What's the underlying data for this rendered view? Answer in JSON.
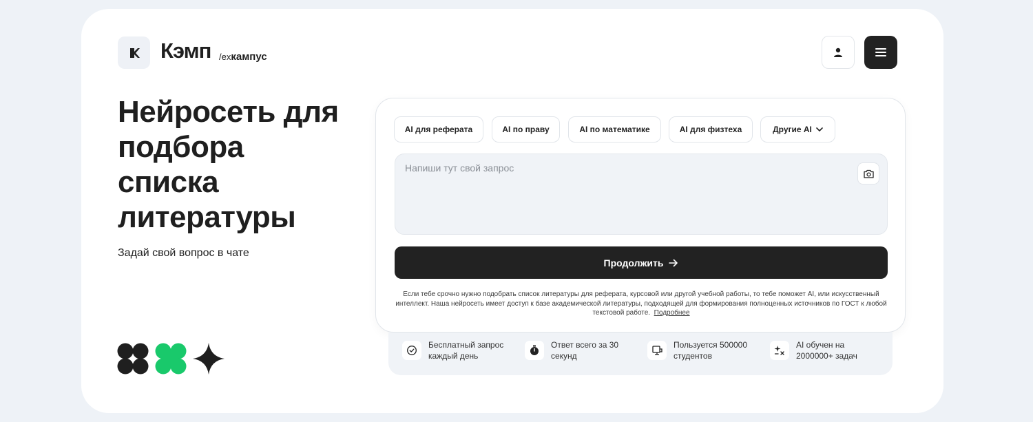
{
  "header": {
    "logo_name": "Кэмп",
    "logo_prefix": "/ex",
    "logo_suffix": "кампус"
  },
  "hero": {
    "title": "Нейросеть для подбора списка литературы",
    "subtitle": "Задай свой вопрос в чате"
  },
  "chips": [
    {
      "label": "AI для реферата"
    },
    {
      "label": "AI по праву"
    },
    {
      "label": "AI по математике"
    },
    {
      "label": "AI для физтеха"
    },
    {
      "label": "Другие AI"
    }
  ],
  "query": {
    "placeholder": "Напиши тут свой запрос",
    "value": ""
  },
  "continue_label": "Продолжить",
  "info": {
    "text": "Если тебе срочно нужно подобрать список литературы для реферата, курсовой или другой учебной работы, то тебе поможет AI, или искусственный интеллект. Наша нейросеть имеет доступ к базе академической литературы, подходящей для формирования полноценных источников по ГОСТ к любой текстовой работе.",
    "more_link": "Подробнее"
  },
  "features": [
    {
      "icon": "check-circle-icon",
      "text": "Бесплатный запрос каждый день"
    },
    {
      "icon": "stopwatch-icon",
      "text": "Ответ всего за 30 секунд"
    },
    {
      "icon": "students-icon",
      "text": "Пользуется 500000 студентов"
    },
    {
      "icon": "sparkle-math-icon",
      "text": "AI обучен на 2000000+ задач"
    }
  ],
  "colors": {
    "background": "#eef2f7",
    "card": "#ffffff",
    "dark": "#222222",
    "accent_green": "#19c96b"
  }
}
